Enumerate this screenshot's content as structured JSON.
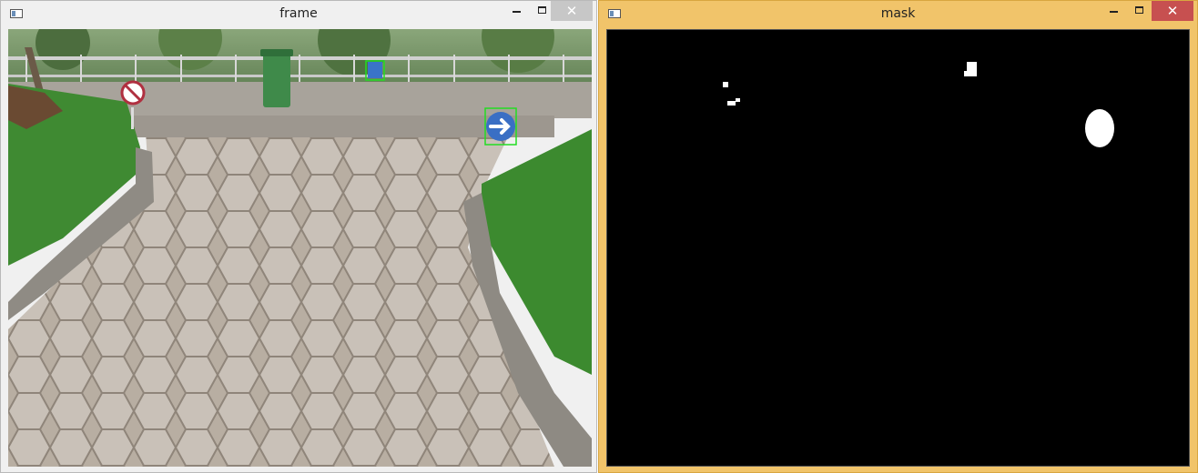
{
  "windows": {
    "frame": {
      "title": "frame"
    },
    "mask": {
      "title": "mask"
    }
  },
  "controls": {
    "minimize_icon": "minimize-icon",
    "maximize_icon": "maximize-icon",
    "close_glyph": "✕"
  },
  "colors": {
    "mask_window_border": "#f1c46a",
    "frame_window_border": "#f0f0f0",
    "detection_box": "#22dd22",
    "mask_background": "#000000",
    "mask_blob": "#ffffff"
  }
}
